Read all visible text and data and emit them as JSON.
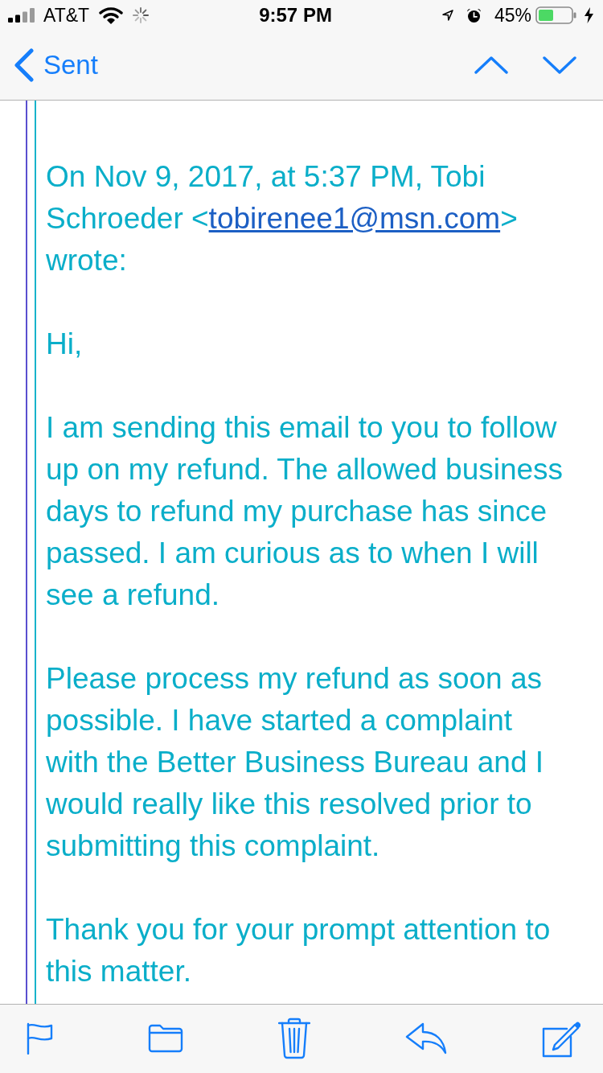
{
  "status_bar": {
    "carrier": "AT&T",
    "time": "9:57 PM",
    "battery": "45%"
  },
  "nav_bar": {
    "back_label": "Sent"
  },
  "message": {
    "attribution": {
      "before": "On Nov 9, 2017, at 5:37 PM, Tobi Schroeder <",
      "email": "tobirenee1@msn.com",
      "after": "> wrote:"
    },
    "paragraphs": [
      "Hi,",
      "I am sending this email to you to follow up on my refund. The allowed business days to refund my purchase has since passed. I am curious as to when I will see a refund.",
      "Please process my refund as soon as possible. I have started a complaint with the Better Business Bureau and I would really like this resolved prior to submitting this complaint.",
      "Thank you for your prompt attention to this matter."
    ]
  }
}
